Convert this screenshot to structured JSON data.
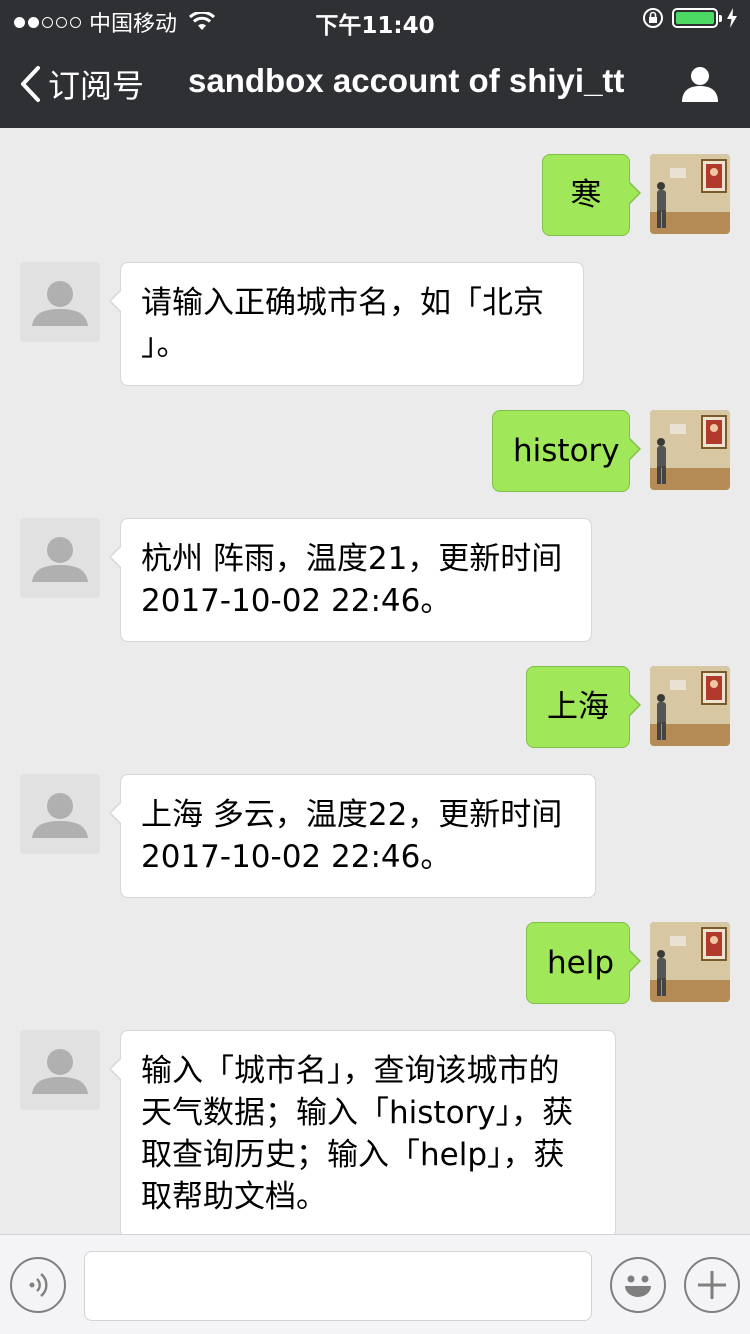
{
  "status_bar": {
    "carrier": "中国移动",
    "time": "下午11:40",
    "signal_icon": "signal-dots-icon",
    "wifi_icon": "wifi-icon",
    "battery_level": 1.0,
    "battery_color": "#4cd964"
  },
  "nav": {
    "back_label": "订阅号",
    "title": "sandbox account of shiyi_tt",
    "user_icon": "user-profile-icon"
  },
  "messages": [
    {
      "side": "out",
      "lines": [
        "寒"
      ]
    },
    {
      "side": "in",
      "lines": [
        "请输入正确城市名，如「北京",
        "」。"
      ]
    },
    {
      "side": "out",
      "lines": [
        "history"
      ]
    },
    {
      "side": "in",
      "lines": [
        "杭州 阵雨，温度21，更新时间",
        "2017-10-02 22:46。"
      ]
    },
    {
      "side": "out",
      "lines": [
        "上海"
      ]
    },
    {
      "side": "in",
      "lines": [
        "上海 多云，温度22，更新时间",
        "2017-10-02 22:46。"
      ]
    },
    {
      "side": "out",
      "lines": [
        "help"
      ]
    },
    {
      "side": "in",
      "lines": [
        "输入「城市名」，查询该城市的",
        "天气数据；输入「history」，获",
        "取查询历史；输入「help」，获",
        "取帮助文档。"
      ]
    }
  ],
  "input_bar": {
    "value": "",
    "voice_icon": "voice-input-icon",
    "emoji_icon": "emoji-icon",
    "plus_icon": "plus-icon"
  },
  "colors": {
    "header_bg": "#2f3033",
    "chat_bg": "#ebebeb",
    "outgoing_bubble": "#a0e75a",
    "incoming_bubble": "#ffffff"
  }
}
